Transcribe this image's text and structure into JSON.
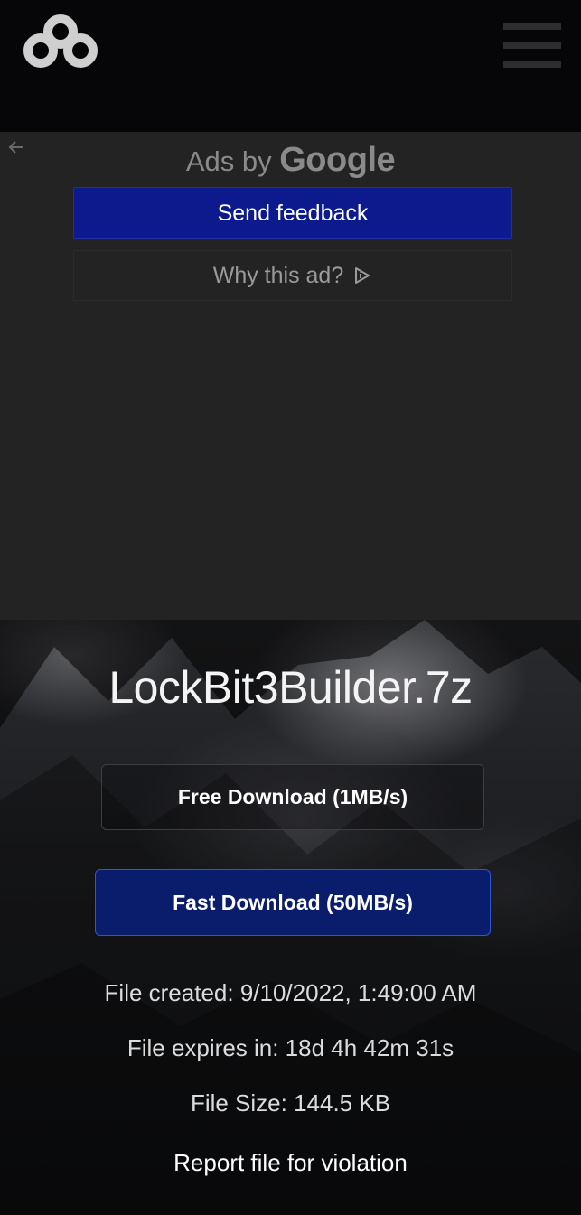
{
  "ad": {
    "ads_by": "Ads by",
    "google": "Google",
    "send_feedback": "Send feedback",
    "why_this_ad": "Why this ad?"
  },
  "file": {
    "name": "LockBit3Builder.7z",
    "free_download": "Free Download (1MB/s)",
    "fast_download": "Fast Download (50MB/s)",
    "created": "File created: 9/10/2022, 1:49:00 AM",
    "expires": "File expires in: 18d 4h 42m 31s",
    "size": "File Size: 144.5 KB",
    "report": "Report file for violation"
  },
  "colors": {
    "header_bg": "#060608",
    "ad_bg": "#232323",
    "send_feedback_bg": "#0c1a8e",
    "fast_download_bg": "#0a1c6c",
    "logo": "#cfcfcf"
  },
  "icons": {
    "logo": "interlocked-loops-logo",
    "menu": "hamburger-menu-icon",
    "back": "back-arrow-icon",
    "adchoices": "adchoices-icon"
  }
}
